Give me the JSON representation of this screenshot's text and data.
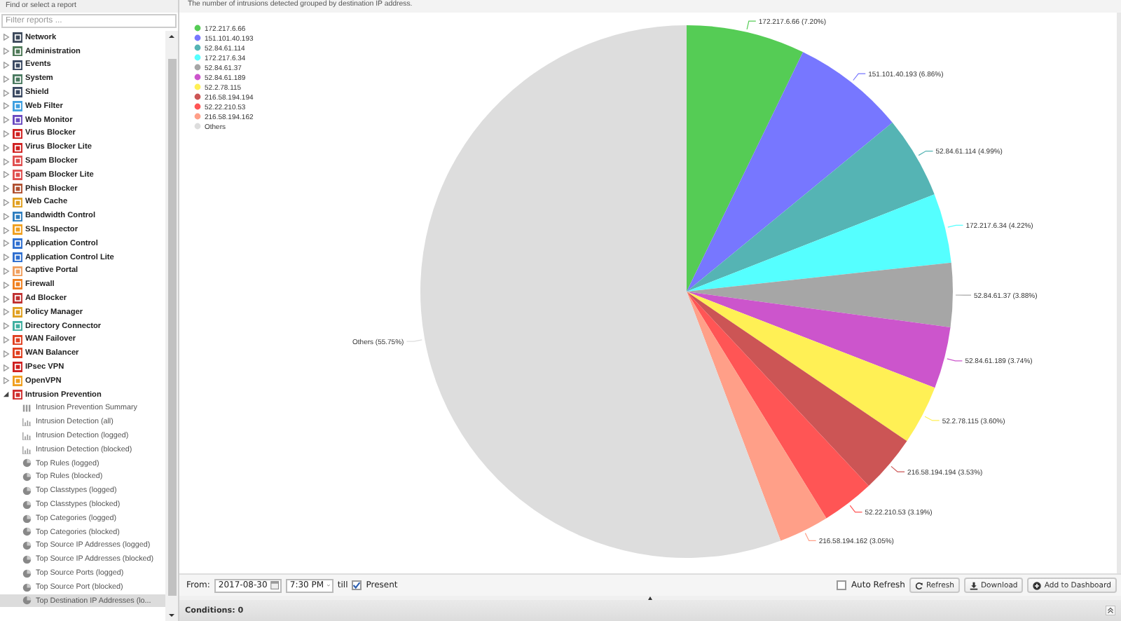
{
  "sidebar": {
    "title": "Find or select a report",
    "filter": {
      "placeholder": "Filter reports ..."
    },
    "items": [
      {
        "label": "Network",
        "expanded": false
      },
      {
        "label": "Administration",
        "expanded": false
      },
      {
        "label": "Events",
        "expanded": false
      },
      {
        "label": "System",
        "expanded": false
      },
      {
        "label": "Shield",
        "expanded": false
      },
      {
        "label": "Web Filter",
        "expanded": false
      },
      {
        "label": "Web Monitor",
        "expanded": false
      },
      {
        "label": "Virus Blocker",
        "expanded": false
      },
      {
        "label": "Virus Blocker Lite",
        "expanded": false
      },
      {
        "label": "Spam Blocker",
        "expanded": false
      },
      {
        "label": "Spam Blocker Lite",
        "expanded": false
      },
      {
        "label": "Phish Blocker",
        "expanded": false
      },
      {
        "label": "Web Cache",
        "expanded": false
      },
      {
        "label": "Bandwidth Control",
        "expanded": false
      },
      {
        "label": "SSL Inspector",
        "expanded": false
      },
      {
        "label": "Application Control",
        "expanded": false
      },
      {
        "label": "Application Control Lite",
        "expanded": false
      },
      {
        "label": "Captive Portal",
        "expanded": false
      },
      {
        "label": "Firewall",
        "expanded": false
      },
      {
        "label": "Ad Blocker",
        "expanded": false
      },
      {
        "label": "Policy Manager",
        "expanded": false
      },
      {
        "label": "Directory Connector",
        "expanded": false
      },
      {
        "label": "WAN Failover",
        "expanded": false
      },
      {
        "label": "WAN Balancer",
        "expanded": false
      },
      {
        "label": "IPsec VPN",
        "expanded": false
      },
      {
        "label": "OpenVPN",
        "expanded": false
      },
      {
        "label": "Intrusion Prevention",
        "expanded": true,
        "children": [
          {
            "label": "Intrusion Prevention Summary",
            "kind": "summary",
            "selected": false
          },
          {
            "label": "Intrusion Detection (all)",
            "kind": "timeseries",
            "selected": false
          },
          {
            "label": "Intrusion Detection (logged)",
            "kind": "timeseries",
            "selected": false
          },
          {
            "label": "Intrusion Detection (blocked)",
            "kind": "timeseries",
            "selected": false
          },
          {
            "label": "Top Rules (logged)",
            "kind": "pie",
            "selected": false
          },
          {
            "label": "Top Rules (blocked)",
            "kind": "pie",
            "selected": false
          },
          {
            "label": "Top Classtypes (logged)",
            "kind": "pie",
            "selected": false
          },
          {
            "label": "Top Classtypes (blocked)",
            "kind": "pie",
            "selected": false
          },
          {
            "label": "Top Categories (logged)",
            "kind": "pie",
            "selected": false
          },
          {
            "label": "Top Categories (blocked)",
            "kind": "pie",
            "selected": false
          },
          {
            "label": "Top Source IP Addresses (logged)",
            "kind": "pie",
            "selected": false
          },
          {
            "label": "Top Source IP Addresses (blocked)",
            "kind": "pie",
            "selected": false
          },
          {
            "label": "Top Source Ports (logged)",
            "kind": "pie",
            "selected": false
          },
          {
            "label": "Top Source Port (blocked)",
            "kind": "pie",
            "selected": false
          },
          {
            "label": "Top Destination IP Addresses (lo...",
            "kind": "pie",
            "selected": true
          }
        ]
      }
    ]
  },
  "report": {
    "description": "The number of intrusions detected grouped by destination IP address.",
    "chart_data": {
      "type": "pie",
      "legend": true,
      "colors": [
        "#55cc55",
        "#7777ff",
        "#55b4b4",
        "#55ffff",
        "#a6a6a6",
        "#cc55cc",
        "#fff055",
        "#cc5555",
        "#ff5555",
        "#ff9f88",
        "#dddddd"
      ],
      "categories": [
        "172.217.6.66",
        "151.101.40.193",
        "52.84.61.114",
        "172.217.6.34",
        "52.84.61.37",
        "52.84.61.189",
        "52.2.78.115",
        "216.58.194.194",
        "52.22.210.53",
        "216.58.194.162",
        "Others"
      ],
      "values": [
        7.2,
        6.86,
        4.99,
        4.22,
        3.88,
        3.74,
        3.6,
        3.53,
        3.19,
        3.05,
        55.75
      ],
      "value_labels": [
        "172.217.6.66 (7.20%)",
        "151.101.40.193 (6.86%)",
        "52.84.61.114 (4.99%)",
        "172.217.6.34 (4.22%)",
        "52.84.61.37 (3.88%)",
        "52.84.61.189 (3.74%)",
        "52.2.78.115 (3.60%)",
        "216.58.194.194 (3.53%)",
        "52.22.210.53 (3.19%)",
        "216.58.194.162 (3.05%)",
        "Others (55.75%)"
      ]
    }
  },
  "toolbar": {
    "from_label": "From:",
    "date": "2017-08-30",
    "time": "7:30 PM",
    "till_label": "till",
    "present": {
      "label": "Present",
      "checked": true
    },
    "auto_refresh": {
      "label": "Auto Refresh",
      "checked": false
    },
    "buttons": [
      {
        "label": "Refresh",
        "kind": "refresh"
      },
      {
        "label": "Download",
        "kind": "download"
      },
      {
        "label": "Add to Dashboard",
        "kind": "add"
      }
    ]
  },
  "conditions": {
    "label": "Conditions: 0"
  }
}
